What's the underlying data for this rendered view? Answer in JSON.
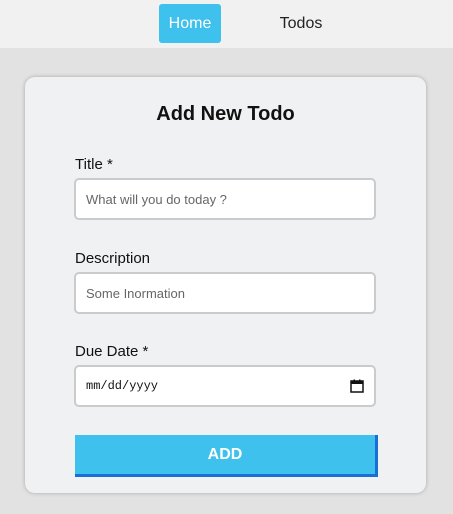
{
  "nav": {
    "home_label": "Home",
    "todos_label": "Todos",
    "active_color": "#3ec1ec"
  },
  "form": {
    "title": "Add New Todo",
    "title_field": {
      "label": "Title *",
      "placeholder": "What will you do today ?",
      "value": ""
    },
    "description_field": {
      "label": "Description",
      "placeholder": "Some Inormation",
      "value": ""
    },
    "due_date_field": {
      "label": "Due Date *",
      "display_value": "mm/dd/yyyy",
      "icon": "calendar-icon"
    },
    "submit_label": "ADD",
    "submit_color": "#3ec1ec",
    "submit_shadow_color": "#1a6fd6"
  }
}
